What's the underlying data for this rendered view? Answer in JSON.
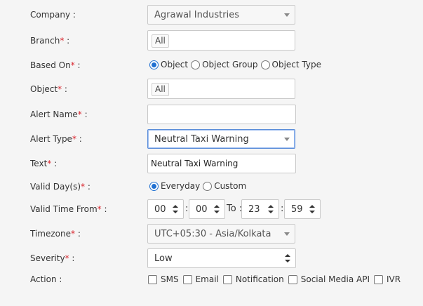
{
  "form": {
    "company": {
      "label": "Company",
      "suffix": " :",
      "value": "Agrawal Industries"
    },
    "branch": {
      "label": "Branch",
      "suffix": " :",
      "tag": "All"
    },
    "based_on": {
      "label": "Based On",
      "suffix": " :",
      "options": [
        "Object",
        "Object Group",
        "Object Type"
      ],
      "selected": "Object"
    },
    "object": {
      "label": "Object",
      "suffix": " :",
      "tag": "All"
    },
    "alert_name": {
      "label": "Alert Name",
      "suffix": " :",
      "value": ""
    },
    "alert_type": {
      "label": "Alert Type",
      "suffix": " :",
      "value": "Neutral Taxi Warning"
    },
    "text": {
      "label": "Text",
      "suffix": " :",
      "value": "Neutral Taxi Warning"
    },
    "valid_days": {
      "label": "Valid Day(s)",
      "suffix": " :",
      "options": [
        "Everyday",
        "Custom"
      ],
      "selected": "Everyday"
    },
    "valid_time": {
      "label": "Valid Time From",
      "suffix": " :",
      "from_hour": "00",
      "from_minute": "00",
      "to_label": "To :",
      "to_hour": "23",
      "to_minute": "59",
      "colon": ":"
    },
    "timezone": {
      "label": "Timezone",
      "suffix": " :",
      "value": "UTC+05:30 - Asia/Kolkata"
    },
    "severity": {
      "label": "Severity",
      "suffix": " :",
      "value": "Low"
    },
    "action": {
      "label": "Action :",
      "options": [
        "SMS",
        "Email",
        "Notification",
        "Social Media API",
        "IVR"
      ]
    },
    "required_mark": "*"
  },
  "colors": {
    "required": "#d9242c",
    "radio_checked": "#1f6fd1",
    "focus_border": "#5b8dd9"
  }
}
